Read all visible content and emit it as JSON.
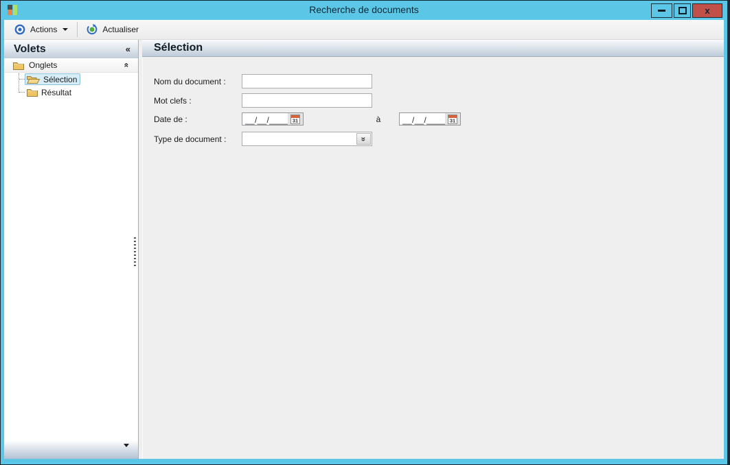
{
  "window": {
    "title": "Recherche de documents",
    "controls": {
      "close_glyph": "x"
    }
  },
  "toolbar": {
    "actions": {
      "label": "Actions"
    },
    "refresh": {
      "label": "Actualiser"
    }
  },
  "sidebar": {
    "header": {
      "title": "Volets",
      "collapse_glyph": "«"
    },
    "group": {
      "label": "Onglets",
      "collapse_glyph": "«"
    },
    "items": [
      {
        "label": "Sélection",
        "selected": true
      },
      {
        "label": "Résultat",
        "selected": false
      }
    ]
  },
  "main": {
    "header": {
      "title": "Sélection"
    },
    "form": {
      "name_field": {
        "label": "Nom du document :",
        "value": ""
      },
      "keywords_field": {
        "label": "Mot clefs :",
        "value": ""
      },
      "date_field": {
        "label": "Date de :",
        "mask_from": "__/__/____",
        "to_label": "à",
        "mask_to": "__/__/____"
      },
      "type_field": {
        "label": "Type de document :",
        "value": "",
        "dropdown_glyph": "»"
      }
    }
  },
  "icons": {
    "app": "colored-squares",
    "actions": "bullseye",
    "refresh": "circular-arrow",
    "collapse_panel": "chevron-left-double",
    "collapse_group": "chevron-up-double",
    "folder_closed": "folder",
    "folder_open": "folder-open",
    "calendar_day": "31",
    "dropdown": "chevron-down-double",
    "scroll_down": "triangle-down",
    "minimize": "dash",
    "maximize": "square",
    "close": "x"
  },
  "colors": {
    "titlebar": "#5CC6E6",
    "close_button": "#C15049",
    "selection_highlight": "#D7EEFA",
    "header_gradient_bottom": "#BECBD9",
    "form_background": "#EFEFEF",
    "calendar_band": "#D8633B"
  }
}
